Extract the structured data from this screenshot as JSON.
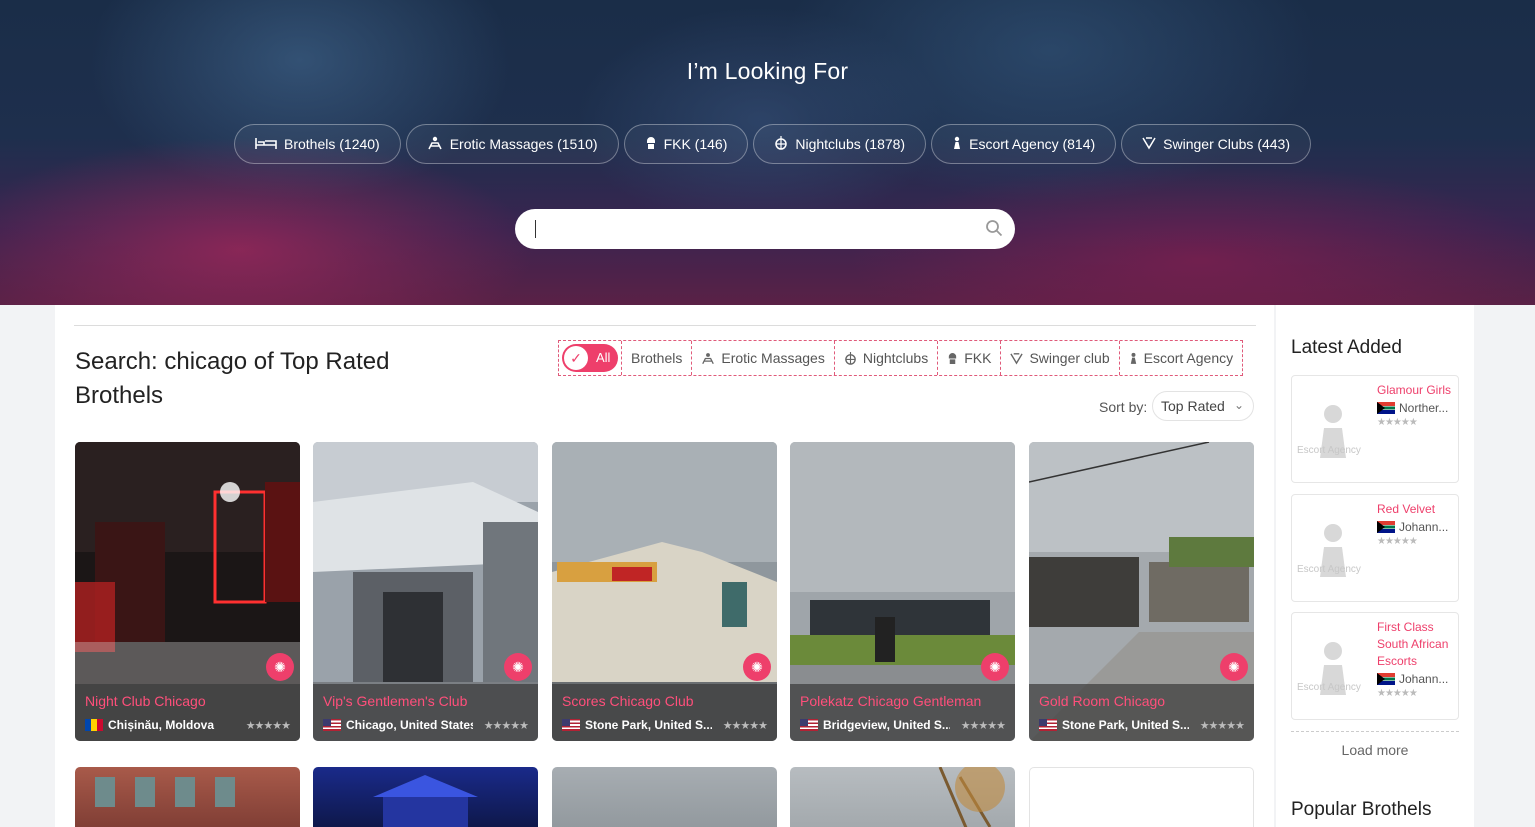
{
  "hero": {
    "title": "I’m Looking For",
    "categories": [
      {
        "label": "Brothels (1240)",
        "icon": "bed-icon"
      },
      {
        "label": "Erotic Massages (1510)",
        "icon": "massage-icon"
      },
      {
        "label": "FKK (146)",
        "icon": "sauna-icon"
      },
      {
        "label": "Nightclubs (1878)",
        "icon": "disco-ball-icon"
      },
      {
        "label": "Escort Agency (814)",
        "icon": "woman-icon"
      },
      {
        "label": "Swinger Clubs (443)",
        "icon": "swinger-icon"
      }
    ],
    "search": {
      "value": "",
      "placeholder": ""
    }
  },
  "main": {
    "heading": "Search: chicago of Top Rated Brothels",
    "filter": {
      "all_label": "All",
      "items": [
        {
          "label": "Brothels"
        },
        {
          "label": "Erotic Massages"
        },
        {
          "label": "Nightclubs"
        },
        {
          "label": "FKK"
        },
        {
          "label": "Swinger club"
        },
        {
          "label": "Escort Agency"
        }
      ]
    },
    "sort": {
      "label": "Sort by:",
      "value": "Top Rated"
    },
    "listings": [
      {
        "name": "Night Club Chicago",
        "location": "Chișinău, Moldova",
        "flag": "md",
        "stars": "★★★★★"
      },
      {
        "name": "Vip's Gentlemen's Club",
        "location": "Chicago, United States",
        "flag": "us",
        "stars": "★★★★★"
      },
      {
        "name": "Scores Chicago Club",
        "location": "Stone Park, United S...",
        "flag": "us",
        "stars": "★★★★★"
      },
      {
        "name": "Polekatz Chicago Gentleman",
        "location": "Bridgeview, United S...",
        "flag": "us",
        "stars": "★★★★★"
      },
      {
        "name": "Gold Room Chicago",
        "location": "Stone Park, United S...",
        "flag": "us",
        "stars": "★★★★★"
      }
    ]
  },
  "sidebar": {
    "latest_title": "Latest Added",
    "latest": [
      {
        "name": "Glamour Girls",
        "location": "Norther...",
        "placeholder_label": "Escort Agency",
        "stars": "★★★★★"
      },
      {
        "name": "Red Velvet",
        "location": "Johann...",
        "placeholder_label": "Escort Agency",
        "stars": "★★★★★"
      },
      {
        "name": "First Class South African Escorts",
        "location": "Johann...",
        "placeholder_label": "Escort Agency",
        "stars": "★★★★★"
      }
    ],
    "load_more": "Load more",
    "popular_title": "Popular Brothels"
  },
  "colors": {
    "accent": "#ee3f6b",
    "hero_dark": "#1e2f4d",
    "hero_magenta": "#5a2146"
  }
}
